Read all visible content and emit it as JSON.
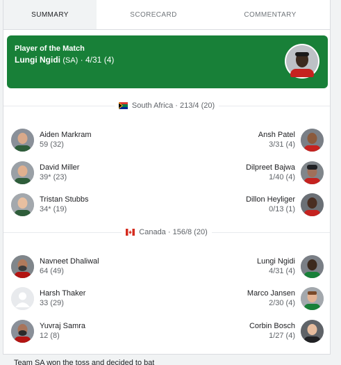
{
  "tabs": [
    {
      "label": "SUMMARY"
    },
    {
      "label": "SCORECARD"
    },
    {
      "label": "COMMENTARY"
    }
  ],
  "potm": {
    "title": "Player of the Match",
    "name": "Lungi Ngidi",
    "team": "(SA)",
    "figures": "· 4/31 (4)",
    "bg_color": "#188038"
  },
  "innings": [
    {
      "team": "South Africa",
      "score": "· 213/4 (20)",
      "batters": [
        {
          "name": "Aiden Markram",
          "stat": "59 (32)"
        },
        {
          "name": "David Miller",
          "stat": "39* (23)"
        },
        {
          "name": "Tristan Stubbs",
          "stat": "34* (19)"
        }
      ],
      "bowlers": [
        {
          "name": "Ansh Patel",
          "stat": "3/31 (4)"
        },
        {
          "name": "Dilpreet Bajwa",
          "stat": "1/40 (4)"
        },
        {
          "name": "Dillon Heyliger",
          "stat": "0/13 (1)"
        }
      ]
    },
    {
      "team": "Canada",
      "score": "· 156/8 (20)",
      "batters": [
        {
          "name": "Navneet Dhaliwal",
          "stat": "64 (49)"
        },
        {
          "name": "Harsh Thaker",
          "stat": "33 (29)"
        },
        {
          "name": "Yuvraj Samra",
          "stat": "12 (8)"
        }
      ],
      "bowlers": [
        {
          "name": "Lungi Ngidi",
          "stat": "4/31 (4)"
        },
        {
          "name": "Marco Jansen",
          "stat": "2/30 (4)"
        },
        {
          "name": "Corbin Bosch",
          "stat": "1/27 (4)"
        }
      ]
    }
  ],
  "footer": {
    "text": "Team SA won the toss and decided to bat"
  }
}
